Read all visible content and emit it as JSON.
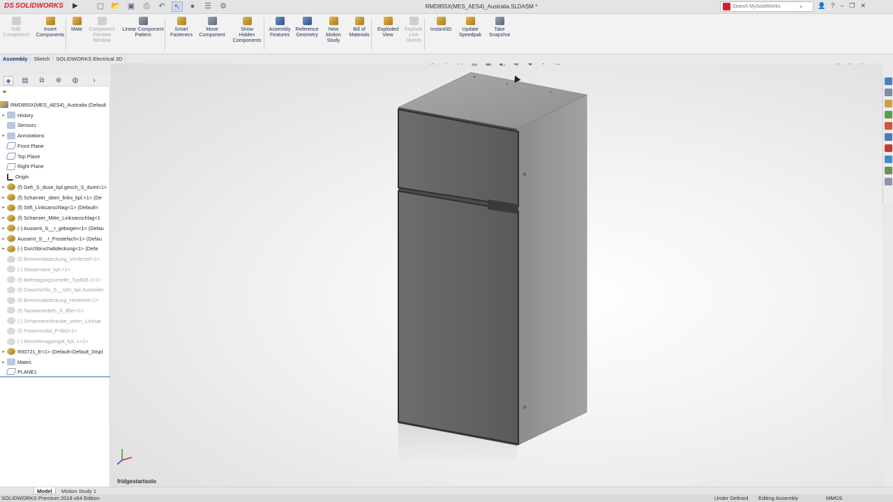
{
  "app": {
    "brand": "SOLIDWORKS",
    "doc_title": "RMD855X(MES_AES4)_Australia.SLDASM *",
    "search_placeholder": "Search MySolidWorks"
  },
  "ribbon": {
    "tools": [
      {
        "label": "Edit\nComponent",
        "disabled": true
      },
      {
        "label": "Insert\nComponents",
        "disabled": false
      },
      {
        "label": "Mate",
        "disabled": false
      },
      {
        "label": "Component\nPreview\nWindow",
        "disabled": true
      },
      {
        "label": "Linear Component\nPattern",
        "disabled": false
      },
      {
        "label": "Smart\nFasteners",
        "disabled": false
      },
      {
        "label": "Move\nComponent",
        "disabled": false
      },
      {
        "label": "Show\nHidden\nComponents",
        "disabled": false
      },
      {
        "label": "Assembly\nFeatures",
        "disabled": false
      },
      {
        "label": "Reference\nGeometry",
        "disabled": false
      },
      {
        "label": "New\nMotion\nStudy",
        "disabled": false
      },
      {
        "label": "Bill of\nMaterials",
        "disabled": false
      },
      {
        "label": "Exploded\nView",
        "disabled": false
      },
      {
        "label": "Explode\nLine\nSketch",
        "disabled": true
      },
      {
        "label": "Instant3D",
        "disabled": false
      },
      {
        "label": "Update\nSpeedpak",
        "disabled": false
      },
      {
        "label": "Take\nSnapshot",
        "disabled": false
      }
    ]
  },
  "command_tabs": [
    "Assembly",
    "Sketch",
    "SOLIDWORKS Electrical 3D"
  ],
  "tree": {
    "root": "RMD855X(MES_AES4)_Australia  (Default",
    "items": [
      {
        "label": "History",
        "type": "folder",
        "suppressed": false
      },
      {
        "label": "Sensors",
        "type": "folder",
        "suppressed": false
      },
      {
        "label": "Annotations",
        "type": "folder",
        "suppressed": false
      },
      {
        "label": "Front Plane",
        "type": "plane",
        "suppressed": false
      },
      {
        "label": "Top Plane",
        "type": "plane",
        "suppressed": false
      },
      {
        "label": "Right Plane",
        "type": "plane",
        "suppressed": false
      },
      {
        "label": "Origin",
        "type": "origin",
        "suppressed": false
      },
      {
        "label": "(f) Geh_S_duse_kpl.gesch_S_dumt<1>",
        "type": "part",
        "suppressed": false
      },
      {
        "label": "(f) Scharnier_oben_links_kpl.<1> (De",
        "type": "part",
        "suppressed": false
      },
      {
        "label": "(f) Stift_Linksanschlag<1> (Default<",
        "type": "part",
        "suppressed": false
      },
      {
        "label": "(f) Scharnier_Mitte_Linksanschlag<1",
        "type": "part",
        "suppressed": false
      },
      {
        "label": "(-) Aussent_S__r_gebogen<1> (Defau",
        "type": "part",
        "suppressed": false
      },
      {
        "label": "Aussent_S__r_Frostefach<1> (Defau",
        "type": "part",
        "suppressed": false
      },
      {
        "label": "(-) Durchbruchabdeckung<1> (Defa",
        "type": "part",
        "suppressed": false
      },
      {
        "label": "(f) Brennerabdeckung_Vorderteil<1>",
        "type": "part",
        "suppressed": true
      },
      {
        "label": "(-) Gasarmatur_kpl.<1>",
        "type": "part",
        "suppressed": true
      },
      {
        "label": "(f) Befestigungsschelle_Typ605.1<1>",
        "type": "part",
        "suppressed": true
      },
      {
        "label": "(f) Gasanschlu_S__rohr_kpl.Australier",
        "type": "part",
        "suppressed": true
      },
      {
        "label": "(f) Brennerabdeckung_Hinterteil<1>",
        "type": "part",
        "suppressed": true
      },
      {
        "label": "(f) Tauwasserbeh_S_dlter<1>",
        "type": "part",
        "suppressed": true
      },
      {
        "label": "(-) Scharnierschraube_unten_Linksar",
        "type": "part",
        "suppressed": true
      },
      {
        "label": "(f) Powermodul_P-860<1>",
        "type": "part",
        "suppressed": true
      },
      {
        "label": "(-) Absorberaggregat_kpl..1<1>",
        "type": "part",
        "suppressed": true
      },
      {
        "label": "R00721_E<1> (Default<Default_Displ",
        "type": "part",
        "suppressed": false
      },
      {
        "label": "Mates",
        "type": "folder",
        "suppressed": false
      },
      {
        "label": "PLANE1",
        "type": "plane",
        "suppressed": false
      }
    ]
  },
  "viewport": {
    "name": "fridgestartsolo"
  },
  "bottom_tabs": [
    "Model",
    "Motion Study 1"
  ],
  "status": {
    "edition": "SOLIDWORKS Premium 2018 x64 Edition",
    "state": "Under Defined",
    "mode": "Editing Assembly",
    "units": "MMGS"
  }
}
